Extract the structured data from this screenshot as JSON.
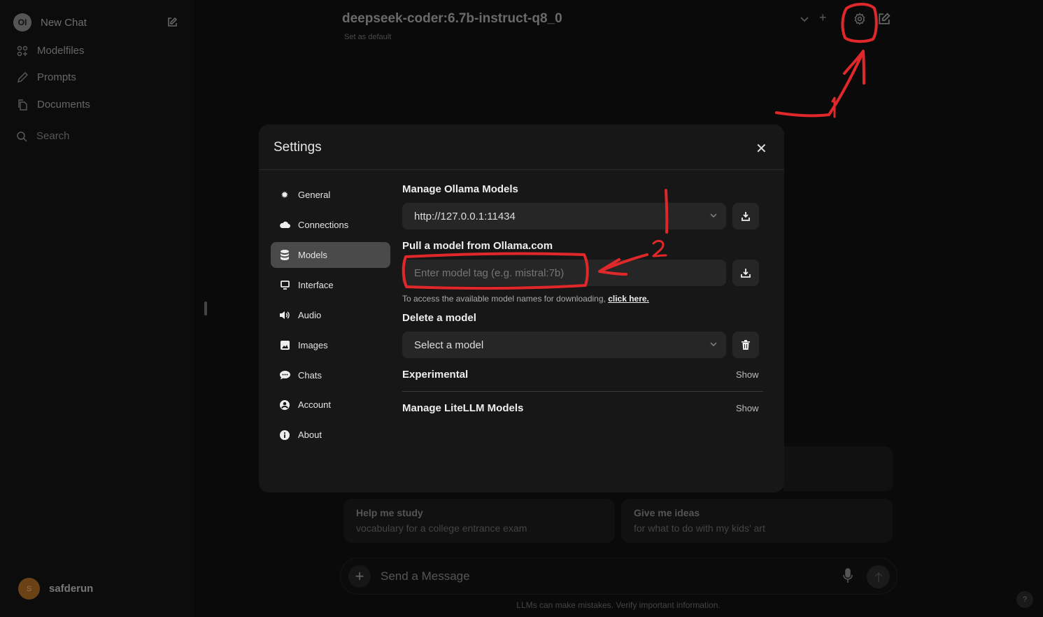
{
  "sidebar": {
    "logo_text": "OI",
    "new_chat": "New Chat",
    "items": [
      {
        "label": "Modelfiles"
      },
      {
        "label": "Prompts"
      },
      {
        "label": "Documents"
      }
    ],
    "search": "Search",
    "user": {
      "initial": "S",
      "name": "safderun"
    }
  },
  "header": {
    "model": "deepseek-coder:6.7b-instruct-q8_0",
    "set_default": "Set as default"
  },
  "suggestions": [
    {
      "title": "Help me study",
      "sub": "vocabulary for a college entrance exam"
    },
    {
      "title": "Give me ideas",
      "sub": "for what to do with my kids' art"
    }
  ],
  "composer": {
    "placeholder": "Send a Message",
    "disclaimer": "LLMs can make mistakes. Verify important information.",
    "help": "?"
  },
  "settings": {
    "title": "Settings",
    "tabs": [
      {
        "label": "General"
      },
      {
        "label": "Connections"
      },
      {
        "label": "Models"
      },
      {
        "label": "Interface"
      },
      {
        "label": "Audio"
      },
      {
        "label": "Images"
      },
      {
        "label": "Chats"
      },
      {
        "label": "Account"
      },
      {
        "label": "About"
      }
    ],
    "active_tab": "Models",
    "manage_ollama": "Manage Ollama Models",
    "ollama_url": "http://127.0.0.1:11434",
    "pull_label": "Pull a model from Ollama.com",
    "pull_placeholder": "Enter model tag (e.g. mistral:7b)",
    "note": "To access the available model names for downloading,",
    "note_link": "click here.",
    "delete_label": "Delete a model",
    "delete_select": "Select a model",
    "experimental": "Experimental",
    "litellm": "Manage LiteLLM Models",
    "show": "Show"
  },
  "annotations": {
    "step1": "1",
    "step2": "2",
    "color": "#e0282a"
  }
}
